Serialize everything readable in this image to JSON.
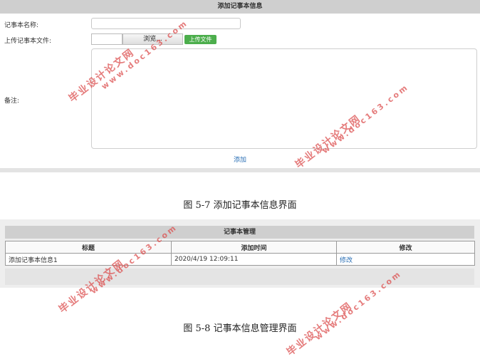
{
  "form": {
    "header": "添加记事本信息",
    "name_label": "记事本名称:",
    "file_label": "上传记事本文件:",
    "browse_label": "浏览...",
    "upload_label": "上传文件",
    "note_label": "备注:",
    "submit_label": "添加"
  },
  "captions": {
    "fig1": "图 5-7 添加记事本信息界面",
    "fig2": "图 5-8 记事本信息管理界面"
  },
  "manage": {
    "header": "记事本管理",
    "columns": [
      "标题",
      "添加时间",
      "修改"
    ],
    "rows": [
      {
        "title": "添加记事本信息1",
        "time": "2020/4/19 12:09:11",
        "action": "修改"
      }
    ]
  },
  "watermark": {
    "cn": "毕业设计论文网",
    "url": "www.doc163.com"
  }
}
